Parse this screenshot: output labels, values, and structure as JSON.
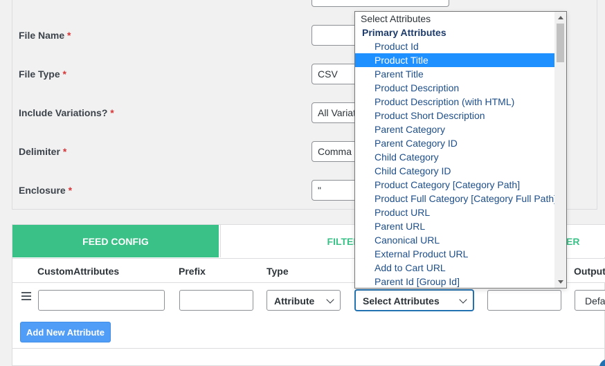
{
  "form": {
    "file_name_label": "File Name",
    "file_type_label": "File Type",
    "file_type_value": "CSV",
    "include_variations_label": "Include Variations?",
    "include_variations_value": "All Variat",
    "delimiter_label": "Delimiter",
    "delimiter_value": "Comma",
    "enclosure_label": "Enclosure",
    "enclosure_value": "\"",
    "required_mark": "*"
  },
  "tabs": {
    "feed_config": "FEED CONFIG",
    "filter": "FILTER",
    "third_partial": "ER"
  },
  "table": {
    "headers": {
      "custom_attributes": "CustomAttributes",
      "prefix": "Prefix",
      "type": "Type",
      "output": "Output"
    },
    "row": {
      "type_value": "Attribute",
      "attribute_value": "Select Attributes",
      "output_value": "Defa"
    }
  },
  "add_button": "Add New Attribute",
  "dropdown": {
    "placeholder": "Select Attributes",
    "group": "Primary Attributes",
    "selected_index": 1,
    "options": [
      "Product Id",
      "Product Title",
      "Parent Title",
      "Product Description",
      "Product Description (with HTML)",
      "Product Short Description",
      "Parent Category",
      "Parent Category ID",
      "Child Category",
      "Child Category ID",
      "Product Category [Category Path]",
      "Product Full Category [Category Full Path]",
      "Product URL",
      "Parent URL",
      "Canonical URL",
      "External Product URL",
      "Add to Cart URL",
      "Parent Id [Group Id]"
    ]
  },
  "colors": {
    "accent_green": "#3ac187",
    "selected_blue": "#1e90ff",
    "button_blue": "#4f9df6",
    "required_red": "#d63638"
  }
}
